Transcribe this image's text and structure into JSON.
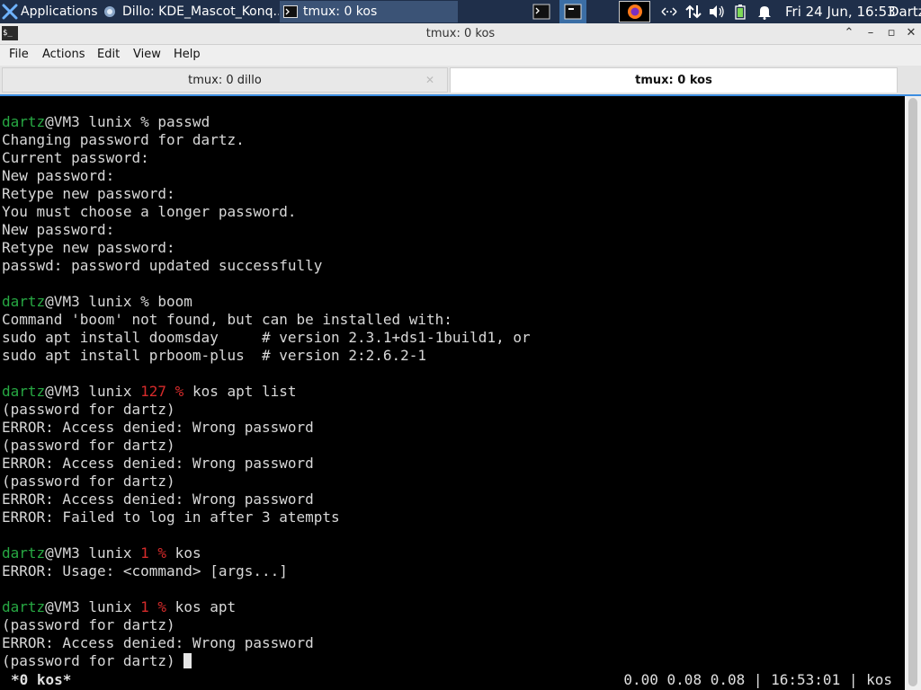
{
  "panel": {
    "applications": "Applications",
    "tasks": [
      {
        "label": "Dillo: KDE_Mascot_Konq..."
      },
      {
        "label": "tmux: 0 kos"
      }
    ],
    "clock": "Fri 24 Jun, 16:53",
    "user": "Dartz"
  },
  "window": {
    "title": "tmux: 0 kos",
    "menu": [
      "File",
      "Actions",
      "Edit",
      "View",
      "Help"
    ],
    "tabs": [
      {
        "label": "tmux: 0 dillo"
      },
      {
        "label": "tmux: 0 kos"
      }
    ]
  },
  "terminal": {
    "lines": [
      {
        "segments": [
          {
            "t": "dartz",
            "c": "user"
          },
          {
            "t": "@VM3 lunix % passwd"
          }
        ]
      },
      {
        "segments": [
          {
            "t": "Changing password for dartz."
          }
        ]
      },
      {
        "segments": [
          {
            "t": "Current password:"
          }
        ]
      },
      {
        "segments": [
          {
            "t": "New password:"
          }
        ]
      },
      {
        "segments": [
          {
            "t": "Retype new password:"
          }
        ]
      },
      {
        "segments": [
          {
            "t": "You must choose a longer password."
          }
        ]
      },
      {
        "segments": [
          {
            "t": "New password:"
          }
        ]
      },
      {
        "segments": [
          {
            "t": "Retype new password:"
          }
        ]
      },
      {
        "segments": [
          {
            "t": "passwd: password updated successfully"
          }
        ]
      },
      {
        "segments": []
      },
      {
        "segments": [
          {
            "t": "dartz",
            "c": "user"
          },
          {
            "t": "@VM3 lunix % boom"
          }
        ]
      },
      {
        "segments": [
          {
            "t": "Command 'boom' not found, but can be installed with:"
          }
        ]
      },
      {
        "segments": [
          {
            "t": "sudo apt install doomsday     # version 2.3.1+ds1-1build1, or"
          }
        ]
      },
      {
        "segments": [
          {
            "t": "sudo apt install prboom-plus  # version 2:2.6.2-1"
          }
        ]
      },
      {
        "segments": []
      },
      {
        "segments": [
          {
            "t": "dartz",
            "c": "user"
          },
          {
            "t": "@VM3 lunix "
          },
          {
            "t": "127 %",
            "c": "err"
          },
          {
            "t": " kos apt list"
          }
        ]
      },
      {
        "segments": [
          {
            "t": "(password for dartz)"
          }
        ]
      },
      {
        "segments": [
          {
            "t": "ERROR: Access denied: Wrong password"
          }
        ]
      },
      {
        "segments": [
          {
            "t": "(password for dartz)"
          }
        ]
      },
      {
        "segments": [
          {
            "t": "ERROR: Access denied: Wrong password"
          }
        ]
      },
      {
        "segments": [
          {
            "t": "(password for dartz)"
          }
        ]
      },
      {
        "segments": [
          {
            "t": "ERROR: Access denied: Wrong password"
          }
        ]
      },
      {
        "segments": [
          {
            "t": "ERROR: Failed to log in after 3 atempts"
          }
        ]
      },
      {
        "segments": []
      },
      {
        "segments": [
          {
            "t": "dartz",
            "c": "user"
          },
          {
            "t": "@VM3 lunix "
          },
          {
            "t": "1 %",
            "c": "err"
          },
          {
            "t": " kos"
          }
        ]
      },
      {
        "segments": [
          {
            "t": "ERROR: Usage: <command> [args...]"
          }
        ]
      },
      {
        "segments": []
      },
      {
        "segments": [
          {
            "t": "dartz",
            "c": "user"
          },
          {
            "t": "@VM3 lunix "
          },
          {
            "t": "1 %",
            "c": "err"
          },
          {
            "t": " kos apt"
          }
        ]
      },
      {
        "segments": [
          {
            "t": "(password for dartz)"
          }
        ]
      },
      {
        "segments": [
          {
            "t": "ERROR: Access denied: Wrong password"
          }
        ]
      },
      {
        "segments": [
          {
            "t": "(password for dartz) "
          }
        ],
        "cursor": true
      }
    ],
    "status_left": "*0 kos*",
    "status_right": "0.00 0.08 0.08 | 16:53:01 | kos"
  },
  "colors": {
    "user": "#27a843",
    "error_code": "#d62b2b",
    "panel_bg": "#1f2f4a",
    "tab_accent": "#3d8ee1"
  },
  "icons": [
    "xfce-menu-icon",
    "dillo-icon",
    "terminal-icon",
    "firefox-icon",
    "network-icon",
    "transfer-icon",
    "volume-icon",
    "battery-icon",
    "notification-bell-icon"
  ]
}
